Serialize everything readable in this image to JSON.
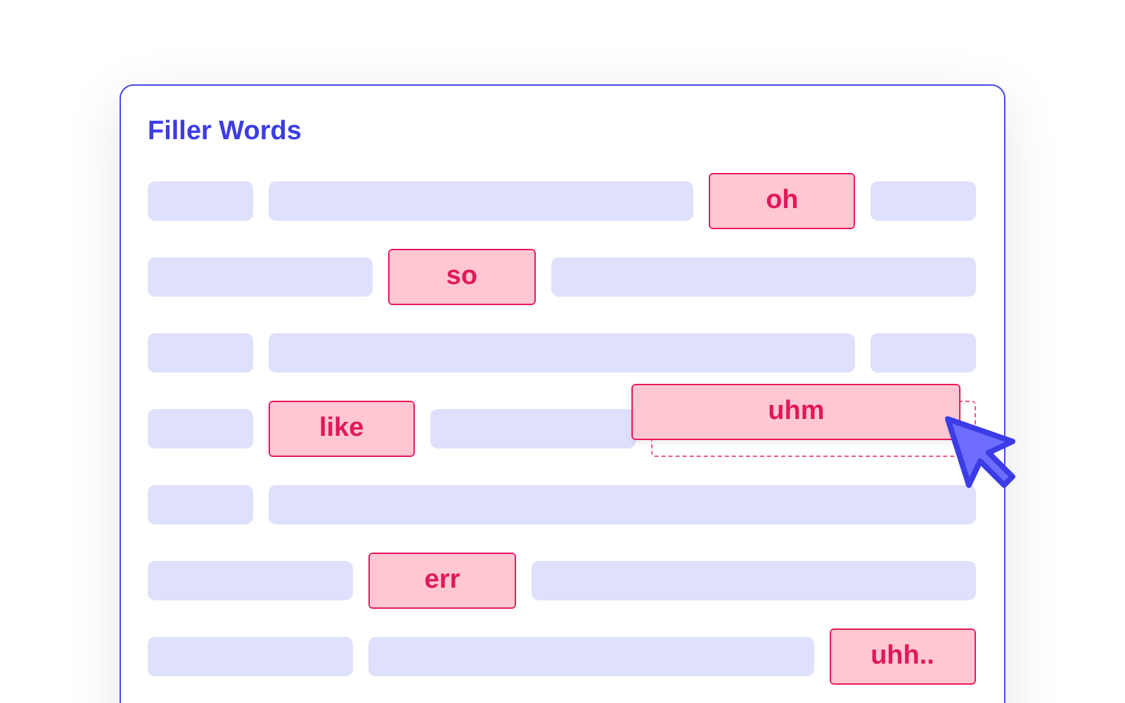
{
  "card": {
    "title": "Filler Words"
  },
  "rows": [
    {
      "items": [
        {
          "kind": "bar"
        },
        {
          "kind": "bar"
        },
        {
          "kind": "word",
          "text": "oh",
          "dragging": false
        },
        {
          "kind": "bar"
        }
      ]
    },
    {
      "items": [
        {
          "kind": "bar"
        },
        {
          "kind": "word",
          "text": "so",
          "dragging": false
        },
        {
          "kind": "bar"
        }
      ]
    },
    {
      "items": [
        {
          "kind": "bar"
        },
        {
          "kind": "bar"
        },
        {
          "kind": "bar"
        }
      ]
    },
    {
      "items": [
        {
          "kind": "bar"
        },
        {
          "kind": "word",
          "text": "like",
          "dragging": false
        },
        {
          "kind": "bar"
        },
        {
          "kind": "word",
          "text": "uhm",
          "dragging": true
        }
      ]
    },
    {
      "items": [
        {
          "kind": "bar"
        },
        {
          "kind": "bar"
        }
      ]
    },
    {
      "items": [
        {
          "kind": "bar"
        },
        {
          "kind": "word",
          "text": "err",
          "dragging": false
        },
        {
          "kind": "bar"
        }
      ]
    },
    {
      "items": [
        {
          "kind": "bar"
        },
        {
          "kind": "bar"
        },
        {
          "kind": "word",
          "text": "uhh..",
          "dragging": false
        }
      ]
    }
  ]
}
